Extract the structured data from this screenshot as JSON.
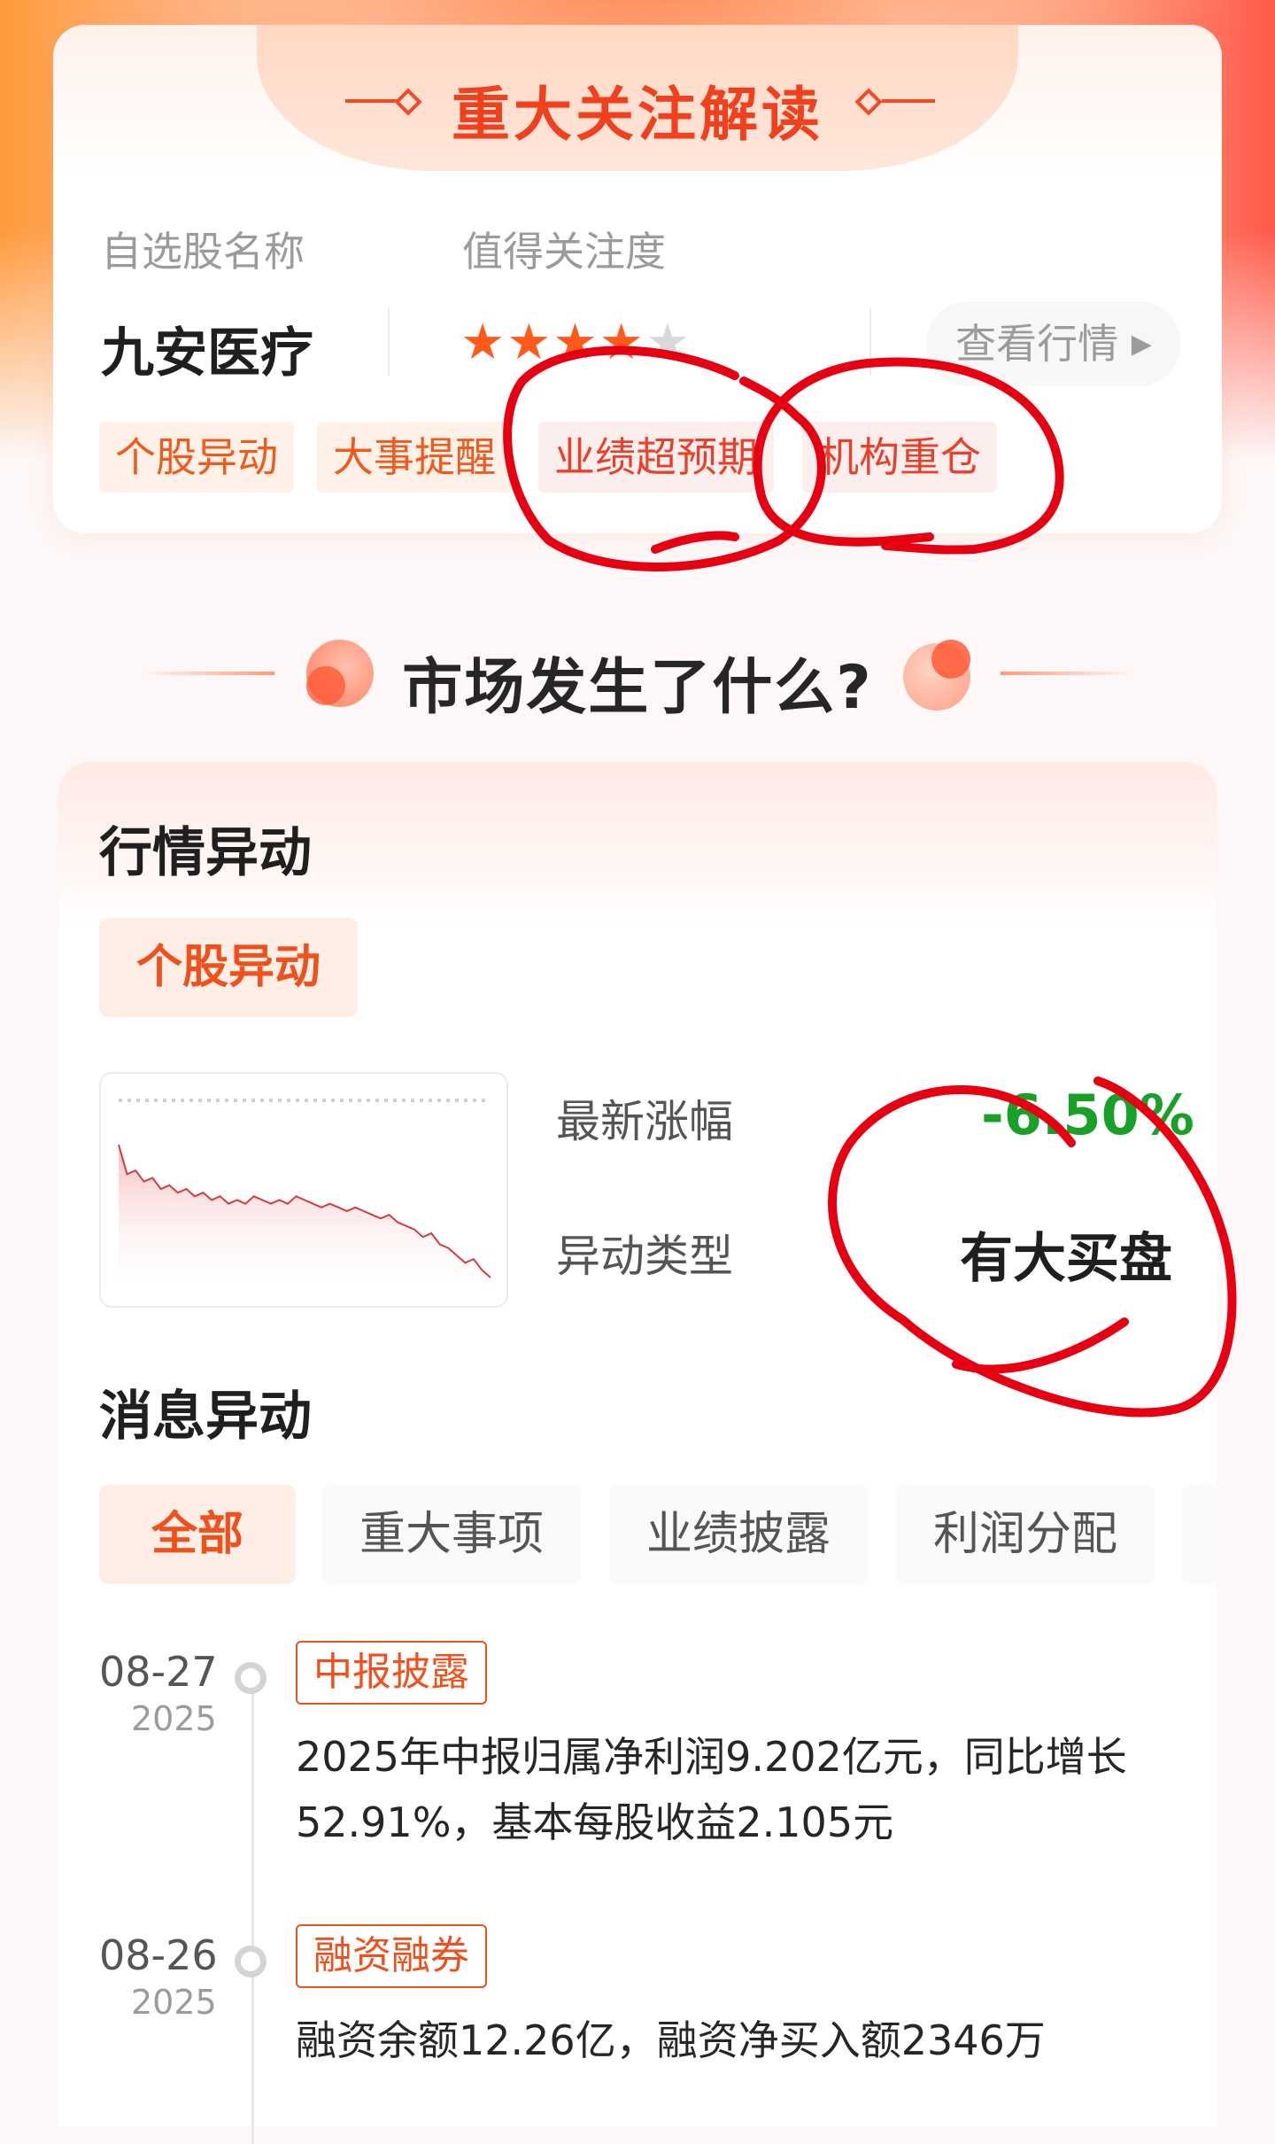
{
  "focus_card": {
    "title": "重大关注解读",
    "col_name_label": "自选股名称",
    "col_attention_label": "值得关注度",
    "stock_name": "九安医疗",
    "rating": 4,
    "rating_max": 5,
    "view_quote_label": "查看行情",
    "tags": [
      "个股异动",
      "大事提醒",
      "业绩超预期",
      "机构重仓"
    ]
  },
  "section": {
    "title": "市场发生了什么?"
  },
  "market_move": {
    "heading": "行情异动",
    "subtag": "个股异动",
    "latest_change_label": "最新涨幅",
    "latest_change_value": "-6.50%",
    "move_type_label": "异动类型",
    "move_type_value": "有大买盘"
  },
  "news": {
    "heading": "消息异动",
    "tabs": [
      "全部",
      "重大事项",
      "业绩披露",
      "利润分配"
    ],
    "active_tab": "全部",
    "items": [
      {
        "date": "08-27",
        "year": "2025",
        "tag": "中报披露",
        "line1": "2025年中报归属净利润9.202亿元，同比增长",
        "line2": "52.91%，基本每股收益2.105元"
      },
      {
        "date": "08-26",
        "year": "2025",
        "tag": "融资融券",
        "line1": "融资余额12.26亿，融资净买入额2346万",
        "line2": ""
      }
    ]
  },
  "colors": {
    "accent": "#f0501c",
    "brand_red": "#f0401d",
    "positive_green": "#18a028",
    "star_on": "#ff5a1a",
    "annotation_red": "#e60012"
  },
  "chart_data": {
    "type": "line",
    "title": "",
    "values": [
      100,
      92,
      93,
      90,
      91,
      88,
      89,
      87,
      88,
      86,
      87,
      85,
      86,
      84,
      85,
      84,
      86,
      85,
      84,
      85,
      84,
      86,
      85,
      84,
      83,
      84,
      83,
      82,
      83,
      82,
      81,
      80,
      81,
      79,
      78,
      77,
      75,
      76,
      73,
      72,
      70,
      68,
      69,
      66,
      64
    ],
    "xlabel": "",
    "ylabel": "",
    "grid": false
  }
}
